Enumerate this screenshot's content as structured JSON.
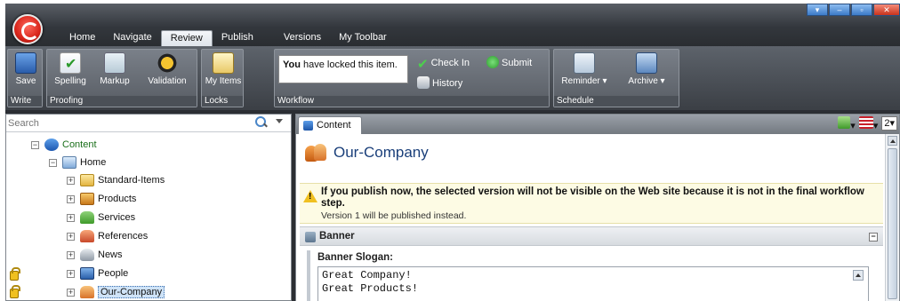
{
  "menu": {
    "tabs": [
      {
        "label": "Home"
      },
      {
        "label": "Navigate"
      },
      {
        "label": "Review"
      },
      {
        "label": "Publish"
      },
      {
        "label": "Versions"
      },
      {
        "label": "My Toolbar"
      }
    ],
    "active_tab": "Review"
  },
  "ribbon": {
    "write": {
      "label": "Write",
      "save": "Save"
    },
    "proofing": {
      "label": "Proofing",
      "spelling": "Spelling",
      "markup": "Markup",
      "validation": "Validation"
    },
    "locks": {
      "label": "Locks",
      "my_items": "My Items"
    },
    "workflow": {
      "label": "Workflow",
      "lock_message_bold": "You",
      "lock_message_rest": " have locked this item.",
      "check_in": "Check In",
      "submit": "Submit",
      "history": "History"
    },
    "schedule": {
      "label": "Schedule",
      "reminder": "Reminder",
      "archive": "Archive"
    }
  },
  "left": {
    "search_placeholder": "Search",
    "tree": [
      {
        "label": "Content",
        "icon": "content-icon",
        "color": "#1a6f1a"
      },
      {
        "label": "Home",
        "icon": "home-icon"
      },
      {
        "label": "Standard-Items",
        "icon": "folder-icon"
      },
      {
        "label": "Products",
        "icon": "products-icon"
      },
      {
        "label": "Services",
        "icon": "services-icon"
      },
      {
        "label": "References",
        "icon": "references-icon"
      },
      {
        "label": "News",
        "icon": "news-icon"
      },
      {
        "label": "People",
        "icon": "people-icon"
      },
      {
        "label": "Our-Company",
        "icon": "company-icon"
      }
    ]
  },
  "right": {
    "tab_label": "Content",
    "version_number": "2",
    "page_title": "Our-Company",
    "warning": "If you publish now, the selected version will not be visible on the Web site because it is not in the final workflow step.",
    "warning_sub": "Version 1 will be published instead.",
    "section_title": "Banner",
    "field_label": "Banner Slogan:",
    "field_value": "Great Company!\nGreat Products!"
  },
  "colors": {
    "accent": "#1a3f7a",
    "content_green": "#1a6f1a",
    "warning_bg": "#fdfbe4"
  }
}
